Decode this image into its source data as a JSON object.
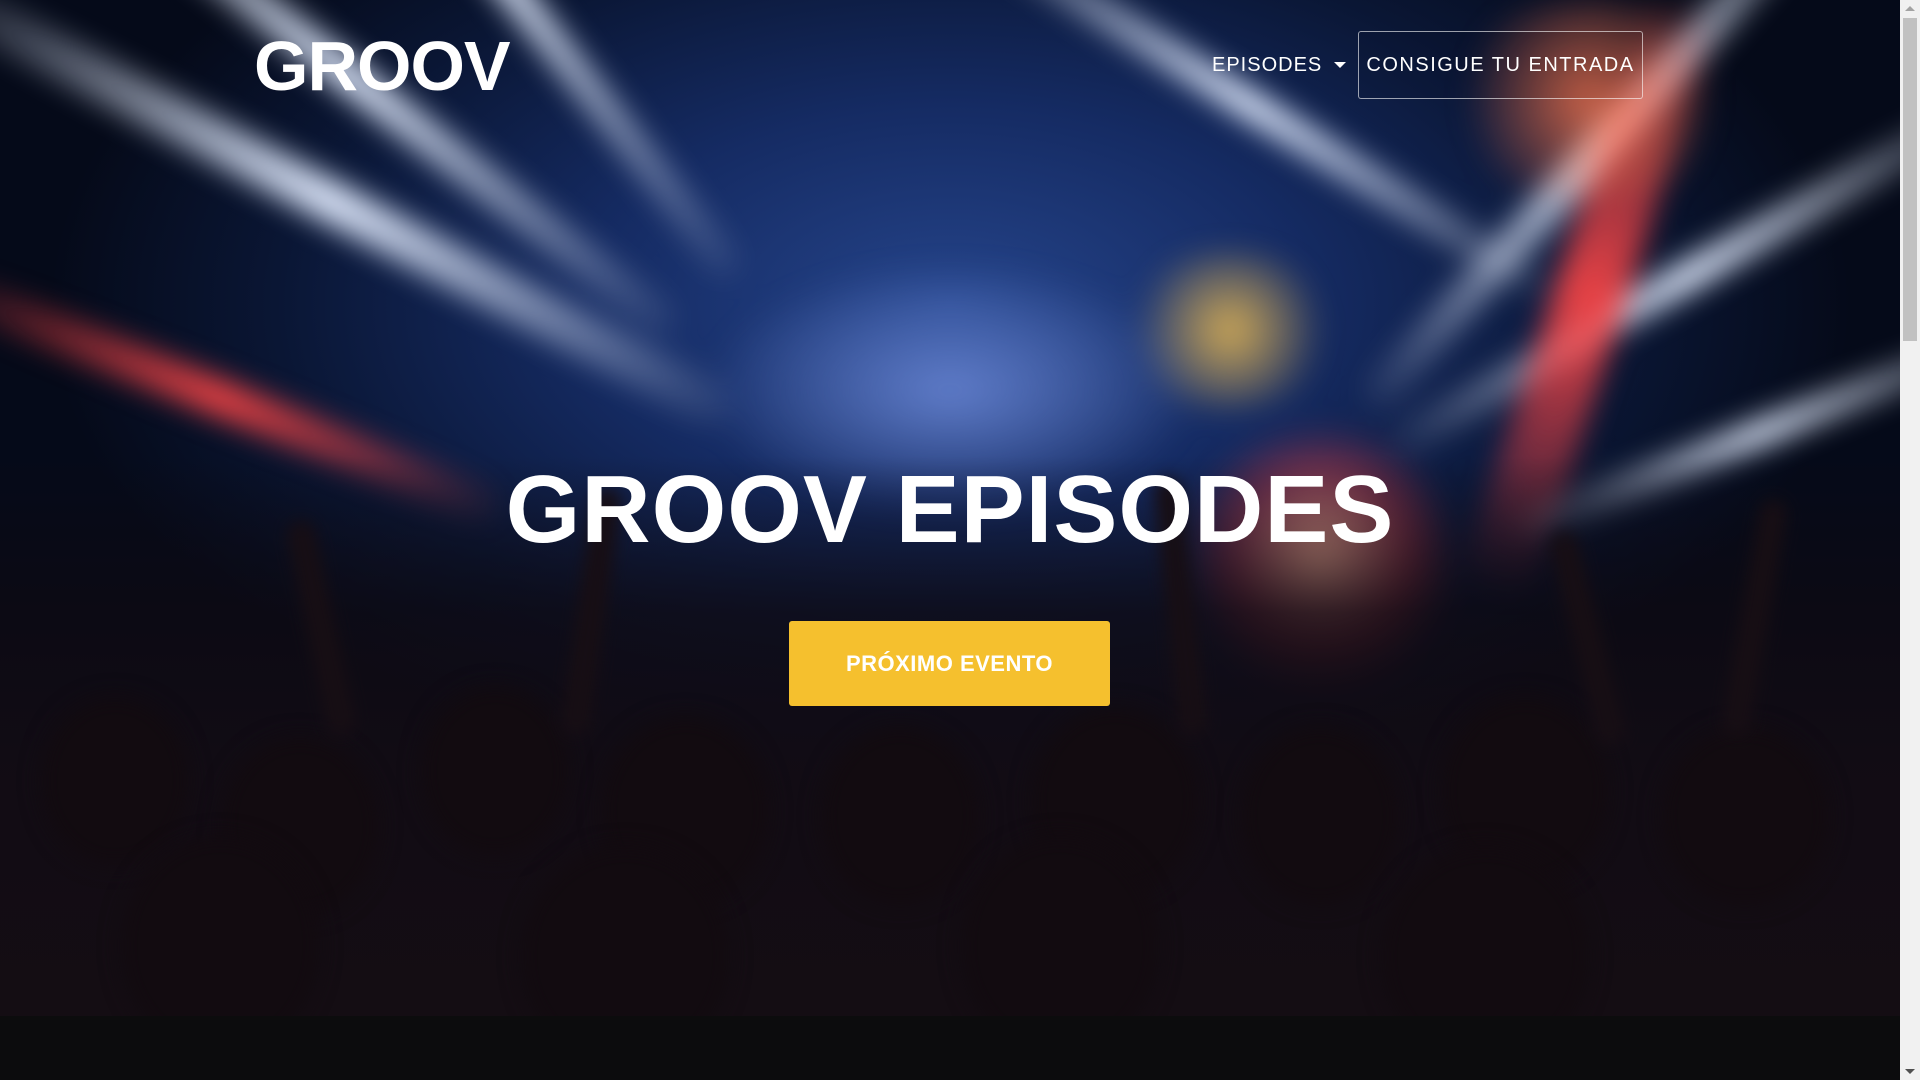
{
  "header": {
    "logo_text": "GROOV",
    "nav_dropdown_label": "EPISODES",
    "ticket_button_label": "CONSIGUE TU ENTRADA"
  },
  "hero": {
    "title": "GROOV EPISODES",
    "cta_label": "PRÓXIMO EVENTO",
    "background_description_icon": "concert-crowd-photo"
  },
  "colors": {
    "cta_background": "#f5c02e",
    "text": "#ffffff",
    "page_background": "#0c0c0d"
  },
  "icons": {
    "dropdown": "caret-down-icon",
    "scroll_up": "scroll-up-arrow-icon",
    "scroll_down": "scroll-down-arrow-icon"
  }
}
